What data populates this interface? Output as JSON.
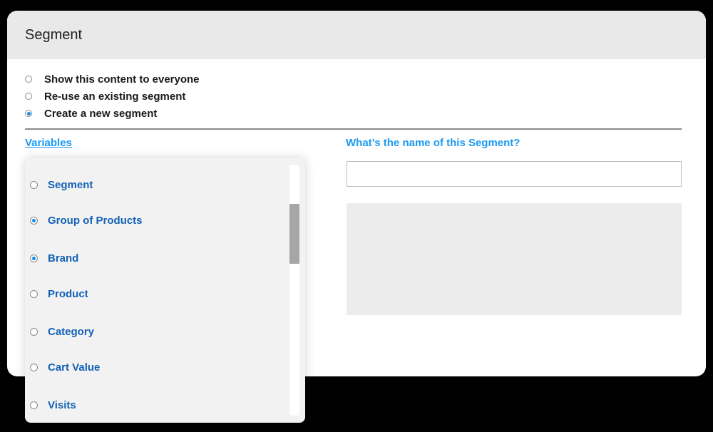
{
  "panel": {
    "title": "Segment"
  },
  "audience_options": [
    {
      "label": "Show this content to everyone",
      "selected": false
    },
    {
      "label": "Re-use an existing segment",
      "selected": false
    },
    {
      "label": "Create a new segment",
      "selected": true
    }
  ],
  "variables": {
    "link_label": "Variables",
    "items": [
      {
        "label": "Segment",
        "selected": false
      },
      {
        "label": "Group of Products",
        "selected": true
      },
      {
        "label": "Brand",
        "selected": true
      },
      {
        "label": "Product",
        "selected": false
      },
      {
        "label": "Category",
        "selected": false
      },
      {
        "label": "Cart Value",
        "selected": false
      },
      {
        "label": "Visits",
        "selected": false
      }
    ]
  },
  "segment_name": {
    "label": "What’s the name of this Segment?",
    "value": "",
    "placeholder": ""
  },
  "colors": {
    "accent": "#1a9af2",
    "item_text": "#1462b8",
    "radio_selected": "#0b8cf0"
  }
}
